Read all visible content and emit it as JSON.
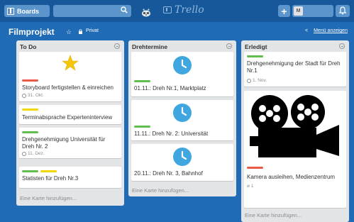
{
  "header": {
    "boards_label": "Boards",
    "logo_text": "Trello",
    "plus_label": "+",
    "user_initial": "M"
  },
  "board": {
    "title": "Filmprojekt",
    "visibility": "Privat",
    "menu_label": "Menü anzeigen"
  },
  "lists": [
    {
      "title": "To Do",
      "cards": [
        {
          "text": "Storyboard fertigstellen & einreichen",
          "due": "31. Okt.",
          "labels": [
            "red"
          ],
          "cover": "star"
        },
        {
          "text": "Terminabsprache Experteninterview",
          "labels": [
            "yellow"
          ]
        },
        {
          "text": "Drehgenehmigung Universität für Dreh Nr. 2",
          "due": "11. Dez.",
          "labels": [
            "green"
          ]
        },
        {
          "text": "Statisten für Dreh Nr.3",
          "labels": [
            "green",
            "yellow"
          ]
        }
      ],
      "add_label": "Eine Karte hinzufügen..."
    },
    {
      "title": "Drehtermine",
      "cards": [
        {
          "text": "01.11.: Dreh Nr.1, Marktplatz",
          "labels": [
            "green"
          ],
          "cover": "clock"
        },
        {
          "text": "11.11.: Dreh Nr. 2: Universität",
          "labels": [
            "green"
          ],
          "cover": "clock"
        },
        {
          "text": "20.11.: Dreh Nr. 3, Bahnhof",
          "cover": "clock"
        }
      ],
      "add_label": "Eine Karte hinzufügen..."
    },
    {
      "title": "Erledigt",
      "cards": [
        {
          "text": "Drehgenehmigung der Stadt für Dreh Nr.1",
          "due": "1. Nov.",
          "labels": [
            "green"
          ]
        },
        {
          "text": "Kamera ausleihen, Medienzentrum",
          "attachments": "1",
          "labels": [
            "red"
          ],
          "cover": "camera"
        }
      ],
      "add_label": "Eine Karte hinzufügen..."
    }
  ],
  "colors": {
    "background": "#1f6bb5",
    "topbar": "#16589a",
    "label_green": "#61bd4f",
    "label_yellow": "#f2d600",
    "label_red": "#eb5a46",
    "clock_blue": "#3fa6e0"
  }
}
